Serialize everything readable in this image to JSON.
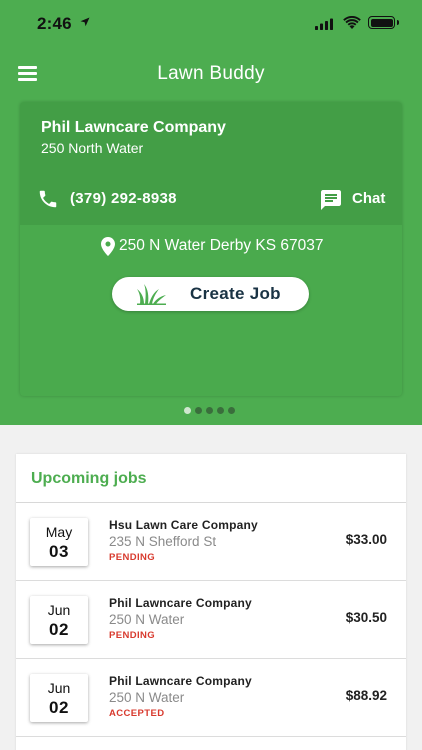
{
  "status_bar": {
    "time": "2:46"
  },
  "header": {
    "title": "Lawn Buddy"
  },
  "company_card": {
    "name": "Phil Lawncare Company",
    "address_short": "250 North Water",
    "phone": "(379) 292-8938",
    "chat_label": "Chat",
    "address_full": "250 N Water Derby KS 67037",
    "create_button_label": "Create Job"
  },
  "pager": {
    "count": 5,
    "active_index": 0
  },
  "upcoming": {
    "title": "Upcoming jobs",
    "jobs": [
      {
        "month": "May",
        "day": "03",
        "company": "Hsu Lawn Care Company",
        "address": "235 N Shefford St",
        "status": "PENDING",
        "price": "$33.00"
      },
      {
        "month": "Jun",
        "day": "02",
        "company": "Phil Lawncare Company",
        "address": "250 N Water",
        "status": "PENDING",
        "price": "$30.50"
      },
      {
        "month": "Jun",
        "day": "02",
        "company": "Phil Lawncare Company",
        "address": "250 N Water",
        "status": "ACCEPTED",
        "price": "$88.92"
      }
    ]
  },
  "colors": {
    "brand_green": "#4dad50",
    "status_red": "#d83a2e"
  }
}
